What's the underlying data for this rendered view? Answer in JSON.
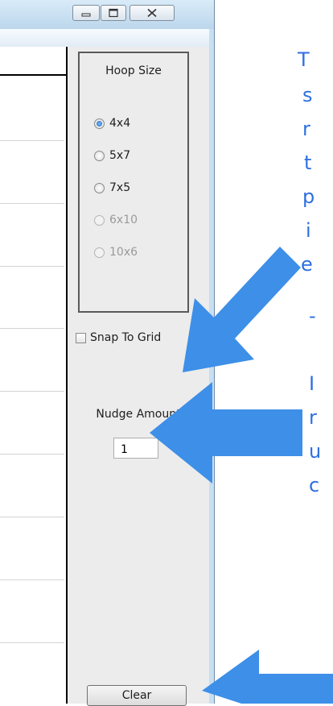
{
  "window": {
    "minimize_icon": "minimize-icon",
    "maximize_icon": "maximize-icon",
    "close_icon": "close-icon"
  },
  "hoop_size": {
    "title": "Hoop Size",
    "options": [
      {
        "label": "4x4",
        "checked": true,
        "enabled": true
      },
      {
        "label": "5x7",
        "checked": false,
        "enabled": true
      },
      {
        "label": "7x5",
        "checked": false,
        "enabled": true
      },
      {
        "label": "6x10",
        "checked": false,
        "enabled": false
      },
      {
        "label": "10x6",
        "checked": false,
        "enabled": false
      }
    ]
  },
  "snap_to_grid": {
    "label": "Snap To Grid",
    "checked": false
  },
  "nudge": {
    "label": "Nudge Amount",
    "value": "1"
  },
  "clear_button": {
    "label": "Clear"
  },
  "annotation": {
    "color": "#3d8fe8",
    "text_color": "#2e6fe0",
    "fragments": [
      "T",
      "s",
      "r",
      "t",
      "p",
      "i",
      "e",
      "-",
      "I",
      "r",
      "u",
      "c"
    ]
  }
}
